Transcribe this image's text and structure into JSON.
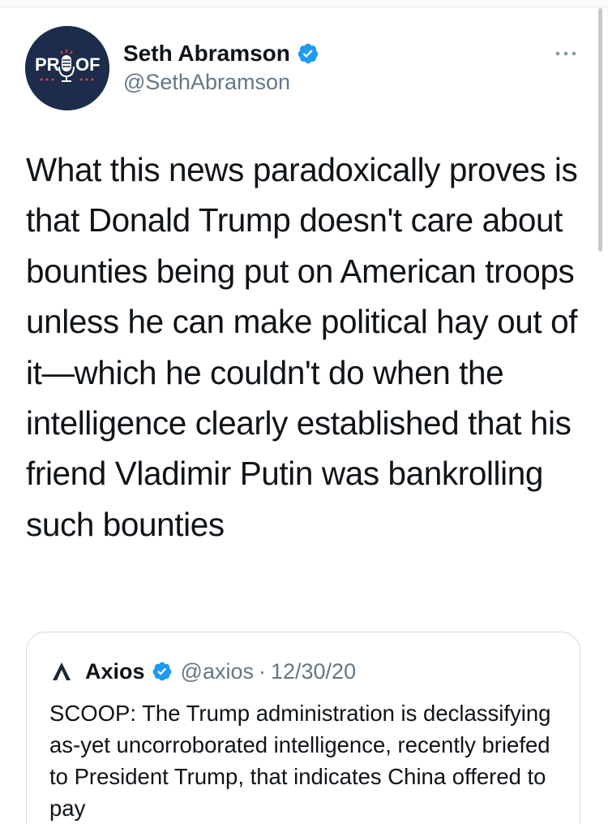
{
  "tweet": {
    "display_name": "Seth Abramson",
    "handle": "@SethAbramson",
    "avatar_text": "PROOF",
    "text": "What this news paradoxically proves is that Donald Trump doesn't care about bounties being put on American troops unless he can make political hay out of it—which he couldn't do when the intelligence clearly established that his friend Vladimir Putin was bankrolling such bounties"
  },
  "quoted_tweet": {
    "display_name": "Axios",
    "handle": "@axios",
    "separator": "·",
    "date": "12/30/20",
    "text": "SCOOP: The Trump administration is declassifying as-yet uncorroborated intelligence, recently briefed to President Trump, that indicates China offered to pay"
  },
  "colors": {
    "verified": "#1d9bf0",
    "avatar_bg": "#1d2c4a",
    "secondary_text": "#657786",
    "border": "#cfd9de"
  },
  "icons": {
    "verified": "verified-badge-icon",
    "more": "more-options-icon",
    "axios_logo": "axios-logo-icon"
  }
}
